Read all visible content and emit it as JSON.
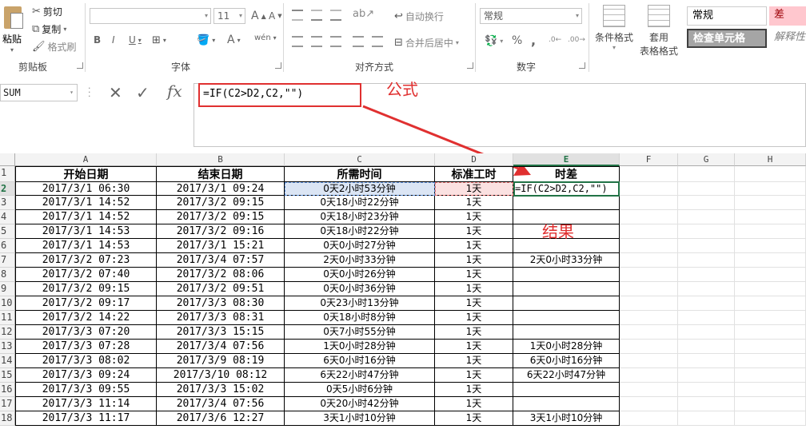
{
  "ribbon": {
    "clipboard": {
      "paste": "粘贴",
      "cut": "剪切",
      "copy": "复制",
      "format_painter": "格式刷",
      "group": "剪贴板"
    },
    "font": {
      "name": "",
      "size": "11",
      "bold": "B",
      "italic": "I",
      "underline": "U",
      "grow": "A",
      "shrink": "A",
      "wen": "wén",
      "group": "字体"
    },
    "alignment": {
      "wrap": "自动换行",
      "merge": "合并后居中",
      "group": "对齐方式"
    },
    "number": {
      "format": "常规",
      "percent": "%",
      "comma": ",",
      "group": "数字"
    },
    "styles": {
      "conditional": "条件格式",
      "table_line1": "套用",
      "table_line2": "表格格式",
      "normal": "常规",
      "bad": "差",
      "check_cell": "检查单元格",
      "explanatory": "解释性"
    }
  },
  "formula_bar": {
    "name_box": "SUM",
    "fx": "fx",
    "formula": "=IF(C2>D2,C2,\"\")"
  },
  "annotations": {
    "formula_label": "公式",
    "result_label": "结果"
  },
  "sheet": {
    "columns": [
      "A",
      "B",
      "C",
      "D",
      "E",
      "F",
      "G",
      "H"
    ],
    "rows": [
      "1",
      "2",
      "3",
      "4",
      "5",
      "6",
      "7",
      "8",
      "9",
      "10",
      "11",
      "12",
      "13",
      "14",
      "15",
      "16",
      "17",
      "18"
    ],
    "headers": [
      "开始日期",
      "结束日期",
      "所需时间",
      "标准工时",
      "时差"
    ],
    "data": [
      [
        "2017/3/1 06:30",
        "2017/3/1 09:24",
        "0天2小时53分钟",
        "1天",
        "=IF(C2>D2,C2,\"\")"
      ],
      [
        "2017/3/1 14:52",
        "2017/3/2 09:15",
        "0天18小时22分钟",
        "1天",
        ""
      ],
      [
        "2017/3/1 14:52",
        "2017/3/2 09:15",
        "0天18小时23分钟",
        "1天",
        ""
      ],
      [
        "2017/3/1 14:53",
        "2017/3/2 09:16",
        "0天18小时22分钟",
        "1天",
        ""
      ],
      [
        "2017/3/1 14:53",
        "2017/3/1 15:21",
        "0天0小时27分钟",
        "1天",
        ""
      ],
      [
        "2017/3/2 07:23",
        "2017/3/4 07:57",
        "2天0小时33分钟",
        "1天",
        "2天0小时33分钟"
      ],
      [
        "2017/3/2 07:40",
        "2017/3/2 08:06",
        "0天0小时26分钟",
        "1天",
        ""
      ],
      [
        "2017/3/2 09:15",
        "2017/3/2 09:51",
        "0天0小时36分钟",
        "1天",
        ""
      ],
      [
        "2017/3/2 09:17",
        "2017/3/3 08:30",
        "0天23小时13分钟",
        "1天",
        ""
      ],
      [
        "2017/3/2 14:22",
        "2017/3/3 08:31",
        "0天18小时8分钟",
        "1天",
        ""
      ],
      [
        "2017/3/3 07:20",
        "2017/3/3 15:15",
        "0天7小时55分钟",
        "1天",
        ""
      ],
      [
        "2017/3/3 07:28",
        "2017/3/4 07:56",
        "1天0小时28分钟",
        "1天",
        "1天0小时28分钟"
      ],
      [
        "2017/3/3 08:02",
        "2017/3/9 08:19",
        "6天0小时16分钟",
        "1天",
        "6天0小时16分钟"
      ],
      [
        "2017/3/3 09:24",
        "2017/3/10 08:12",
        "6天22小时47分钟",
        "1天",
        "6天22小时47分钟"
      ],
      [
        "2017/3/3 09:55",
        "2017/3/3 15:02",
        "0天5小时6分钟",
        "1天",
        ""
      ],
      [
        "2017/3/3 11:14",
        "2017/3/4 07:56",
        "0天20小时42分钟",
        "1天",
        ""
      ],
      [
        "2017/3/3 11:17",
        "2017/3/6 12:27",
        "3天1小时10分钟",
        "1天",
        "3天1小时10分钟"
      ]
    ]
  },
  "colors": {
    "accent": "#217346",
    "annotation": "#e03030"
  }
}
